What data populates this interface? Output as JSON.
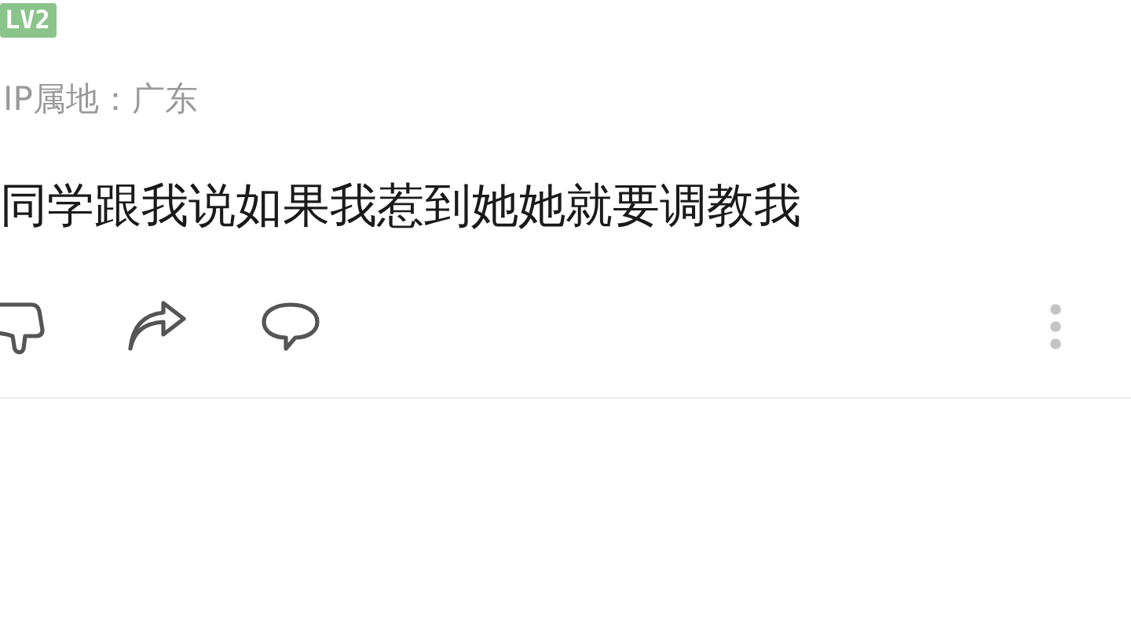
{
  "level_badge": "LV2",
  "ip_location": "IP属地：广东",
  "comment": "同学跟我说如果我惹到她她就要调教我"
}
